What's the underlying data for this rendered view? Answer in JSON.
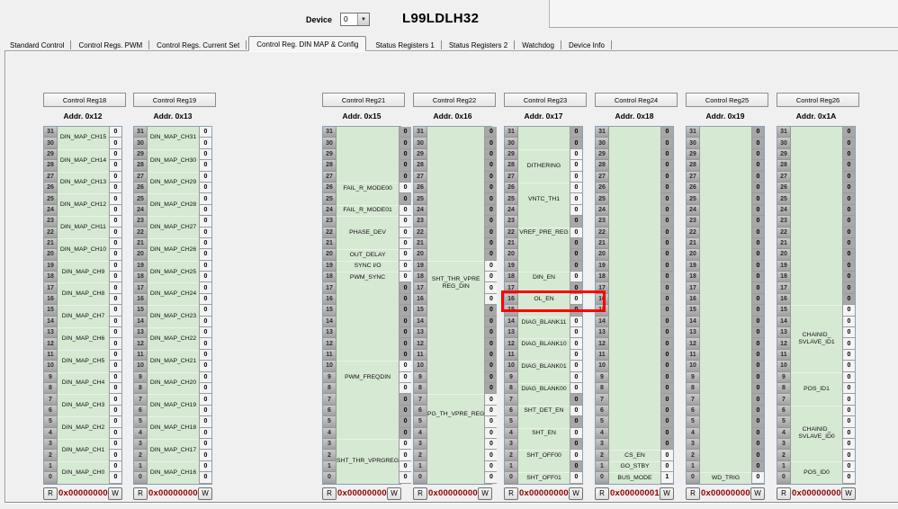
{
  "header": {
    "device_label": "Device",
    "device_value": "0",
    "title": "L99LDLH32",
    "dropdown_arrow": "▼"
  },
  "tabs": {
    "active_index": 3,
    "items": [
      {
        "label": "Standard Control"
      },
      {
        "label": "Control Regs. PWM"
      },
      {
        "label": "Control Regs. Current Set"
      },
      {
        "label": "Control Reg. DIN MAP & Config"
      },
      {
        "label": "Status Registers 1"
      },
      {
        "label": "Status Registers 2"
      },
      {
        "label": "Watchdog"
      },
      {
        "label": "Device Info"
      }
    ]
  },
  "controls": {
    "read_label": "R",
    "write_label": "W"
  },
  "bit_indices": [
    31,
    30,
    29,
    28,
    27,
    26,
    25,
    24,
    23,
    22,
    21,
    20,
    19,
    18,
    17,
    16,
    15,
    14,
    13,
    12,
    11,
    10,
    9,
    8,
    7,
    6,
    5,
    4,
    3,
    2,
    1,
    0
  ],
  "colors": {
    "field_area_green": "#d6e9d3",
    "reserved_cell_gray": "#a8a8a8",
    "editable_cell": "#f4f4f4",
    "hex_value_red": "#8b0000",
    "highlight_red": "#ff0000"
  },
  "highlight": {
    "register_index": 4,
    "bit": 16
  },
  "registers": [
    {
      "name": "Control Reg18",
      "addr": "Addr. 0x12",
      "hex": "0x00000000",
      "light": "all",
      "values": {},
      "fields": [
        {
          "label": "DIN_MAP_CH15",
          "msb": 31,
          "lsb": 30
        },
        {
          "label": "DIN_MAP_CH14",
          "msb": 29,
          "lsb": 28
        },
        {
          "label": "DIN_MAP_CH13",
          "msb": 27,
          "lsb": 26
        },
        {
          "label": "DIN_MAP_CH12",
          "msb": 25,
          "lsb": 24
        },
        {
          "label": "DIN_MAP_CH11",
          "msb": 23,
          "lsb": 22
        },
        {
          "label": "DIN_MAP_CH10",
          "msb": 21,
          "lsb": 20
        },
        {
          "label": "DIN_MAP_CH9",
          "msb": 19,
          "lsb": 18
        },
        {
          "label": "DIN_MAP_CH8",
          "msb": 17,
          "lsb": 16
        },
        {
          "label": "DIN_MAP_CH7",
          "msb": 15,
          "lsb": 14
        },
        {
          "label": "DIN_MAP_CH6",
          "msb": 13,
          "lsb": 12
        },
        {
          "label": "DIN_MAP_CH5",
          "msb": 11,
          "lsb": 10
        },
        {
          "label": "DIN_MAP_CH4",
          "msb": 9,
          "lsb": 8
        },
        {
          "label": "DIN_MAP_CH3",
          "msb": 7,
          "lsb": 6
        },
        {
          "label": "DIN_MAP_CH2",
          "msb": 5,
          "lsb": 4
        },
        {
          "label": "DIN_MAP_CH1",
          "msb": 3,
          "lsb": 2
        },
        {
          "label": "DIN_MAP_CH0",
          "msb": 1,
          "lsb": 0
        }
      ]
    },
    {
      "name": "Control Reg19",
      "addr": "Addr. 0x13",
      "hex": "0x00000000",
      "light": "all",
      "values": {},
      "fields": [
        {
          "label": "DIN_MAP_CH31",
          "msb": 31,
          "lsb": 30
        },
        {
          "label": "DIN_MAP_CH30",
          "msb": 29,
          "lsb": 28
        },
        {
          "label": "DIN_MAP_CH29",
          "msb": 27,
          "lsb": 26
        },
        {
          "label": "DIN_MAP_CH28",
          "msb": 25,
          "lsb": 24
        },
        {
          "label": "DIN_MAP_CH27",
          "msb": 23,
          "lsb": 22
        },
        {
          "label": "DIN_MAP_CH26",
          "msb": 21,
          "lsb": 20
        },
        {
          "label": "DIN_MAP_CH25",
          "msb": 19,
          "lsb": 18
        },
        {
          "label": "DIN_MAP_CH24",
          "msb": 17,
          "lsb": 16
        },
        {
          "label": "DIN_MAP_CH23",
          "msb": 15,
          "lsb": 14
        },
        {
          "label": "DIN_MAP_CH22",
          "msb": 13,
          "lsb": 12
        },
        {
          "label": "DIN_MAP_CH21",
          "msb": 11,
          "lsb": 10
        },
        {
          "label": "DIN_MAP_CH20",
          "msb": 9,
          "lsb": 8
        },
        {
          "label": "DIN_MAP_CH19",
          "msb": 7,
          "lsb": 6
        },
        {
          "label": "DIN_MAP_CH18",
          "msb": 5,
          "lsb": 4
        },
        {
          "label": "DIN_MAP_CH17",
          "msb": 3,
          "lsb": 2
        },
        {
          "label": "DIN_MAP_CH16",
          "msb": 1,
          "lsb": 0
        }
      ]
    },
    {
      "name": "Control Reg21",
      "addr": "Addr. 0x15",
      "hex": "0x00000000",
      "light": [
        26,
        24,
        23,
        22,
        21,
        20,
        19,
        18,
        10,
        9,
        8,
        3,
        2,
        1,
        0
      ],
      "values": {},
      "fields": [
        {
          "label": "FAIL_R_MODE00",
          "msb": 26,
          "lsb": 26
        },
        {
          "label": "FAIL_R_MODE01",
          "msb": 24,
          "lsb": 24
        },
        {
          "label": "PHASE_DEV",
          "msb": 23,
          "lsb": 21
        },
        {
          "label": "OUT_DELAY",
          "msb": 20,
          "lsb": 20
        },
        {
          "label": "SYNC I/O",
          "msb": 19,
          "lsb": 19
        },
        {
          "label": "PWM_SYNC",
          "msb": 18,
          "lsb": 18
        },
        {
          "label": "PWM_FREQDIN",
          "msb": 10,
          "lsb": 8
        },
        {
          "label": "SHT_THR_VPRGREG",
          "msb": 3,
          "lsb": 0
        }
      ]
    },
    {
      "name": "Control Reg22",
      "addr": "Addr. 0x16",
      "hex": "0x00000000",
      "light": [
        19,
        18,
        17,
        16,
        7,
        6,
        5,
        4,
        3,
        2,
        1,
        0
      ],
      "values": {},
      "fields": [
        {
          "label": "SHT_THR_VPRE\nREG_DIN",
          "msb": 19,
          "lsb": 16
        },
        {
          "label": "PG_TH_VPRE_REG",
          "msb": 7,
          "lsb": 0,
          "bias": "up",
          "pad": 18
        }
      ]
    },
    {
      "name": "Control Reg23",
      "addr": "Addr. 0x17",
      "hex": "0x00000000",
      "light": [
        29,
        28,
        27,
        26,
        25,
        24,
        22,
        18,
        16,
        14,
        13,
        12,
        11,
        10,
        9,
        8,
        6,
        4,
        2,
        0
      ],
      "values": {},
      "fields": [
        {
          "label": "DITHERING",
          "msb": 29,
          "lsb": 27
        },
        {
          "label": "VNTC_TH1",
          "msb": 26,
          "lsb": 24
        },
        {
          "label": "VREF_PRE_REG",
          "msb": 22,
          "lsb": 22
        },
        {
          "label": "DIN_EN",
          "msb": 18,
          "lsb": 18
        },
        {
          "label": "OL_EN",
          "msb": 16,
          "lsb": 16
        },
        {
          "label": "DIAG_BLANK11",
          "msb": 14,
          "lsb": 13,
          "bias": "up"
        },
        {
          "label": "DIAG_BLANK10",
          "msb": 12,
          "lsb": 11,
          "bias": "up"
        },
        {
          "label": "DIAG_BLANK01",
          "msb": 10,
          "lsb": 9,
          "bias": "up"
        },
        {
          "label": "DIAG_BLANK00",
          "msb": 8,
          "lsb": 8
        },
        {
          "label": "SHT_DET_EN",
          "msb": 6,
          "lsb": 6
        },
        {
          "label": "SHT_EN",
          "msb": 4,
          "lsb": 4
        },
        {
          "label": "SHT_OFF00",
          "msb": 2,
          "lsb": 2
        },
        {
          "label": "SHT_OFF01",
          "msb": 0,
          "lsb": 0
        }
      ]
    },
    {
      "name": "Control Reg24",
      "addr": "Addr. 0x18",
      "hex": "0x00000001",
      "light": [
        2,
        1,
        0
      ],
      "values": {
        "0": "1"
      },
      "fields": [
        {
          "label": "CS_EN",
          "msb": 2,
          "lsb": 2
        },
        {
          "label": "GO_STBY",
          "msb": 1,
          "lsb": 1
        },
        {
          "label": "BUS_MODE",
          "msb": 0,
          "lsb": 0
        }
      ]
    },
    {
      "name": "Control Reg25",
      "addr": "Addr. 0x19",
      "hex": "0x00000000",
      "light": [
        0
      ],
      "values": {},
      "fields": [
        {
          "label": "WD_TRIG",
          "msb": 0,
          "lsb": 0
        }
      ]
    },
    {
      "name": "Control Reg26",
      "addr": "Addr. 0x1A",
      "hex": "0x00000000",
      "light": [
        15,
        14,
        13,
        12,
        11,
        10,
        9,
        8,
        7,
        6,
        5,
        4,
        3,
        2,
        1,
        0
      ],
      "values": {},
      "fields": [
        {
          "label": "CHAINID_\nSVLAVE_ID1",
          "msb": 15,
          "lsb": 10
        },
        {
          "label": "POS_ID1",
          "msb": 9,
          "lsb": 7
        },
        {
          "label": "CHAINID_\nSVLAVE_ID0",
          "msb": 6,
          "lsb": 2
        },
        {
          "label": "POS_ID0",
          "msb": 1,
          "lsb": 0
        }
      ]
    }
  ]
}
